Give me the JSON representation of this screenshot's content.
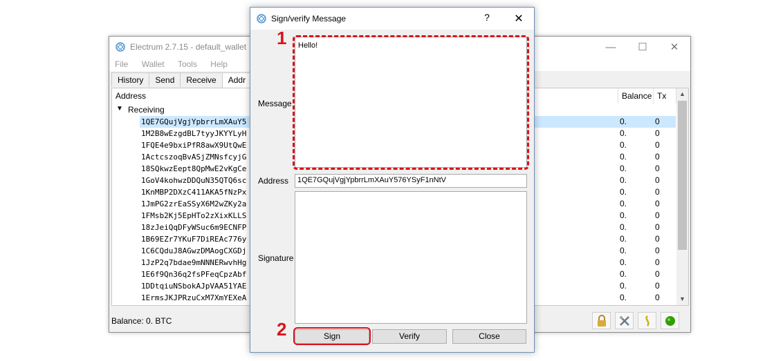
{
  "main_window": {
    "title": "Electrum 2.7.15  -  default_wallet",
    "menu": [
      "File",
      "Wallet",
      "Tools",
      "Help"
    ],
    "tabs": [
      "History",
      "Send",
      "Receive",
      "Addr"
    ],
    "columns": {
      "address": "Address",
      "balance": "Balance",
      "tx": "Tx"
    },
    "tree_group": "Receiving",
    "rows": [
      {
        "address": "1QE7GQujVgjYpbrrLmXAuY5",
        "balance": "0.",
        "tx": "0"
      },
      {
        "address": "1M2B8wEzgdBL7tyyJKYYLyH",
        "balance": "0.",
        "tx": "0"
      },
      {
        "address": "1FQE4e9bxiPfR8awX9UtQwE",
        "balance": "0.",
        "tx": "0"
      },
      {
        "address": "1ActcszoqBvASjZMNsfcyjG",
        "balance": "0.",
        "tx": "0"
      },
      {
        "address": "18SQkwzEept8QpMwE2vKgCe",
        "balance": "0.",
        "tx": "0"
      },
      {
        "address": "1GoV4kohwzDDQuN35QTQ6sc",
        "balance": "0.",
        "tx": "0"
      },
      {
        "address": "1KnMBP2DXzC411AKA5fNzPx",
        "balance": "0.",
        "tx": "0"
      },
      {
        "address": "1JmPG2zrEaSSyX6M2wZKy2a",
        "balance": "0.",
        "tx": "0"
      },
      {
        "address": "1FMsb2Kj5EpHTo2zXixKLLS",
        "balance": "0.",
        "tx": "0"
      },
      {
        "address": "18zJeiQqDFyWSuc6m9ECNFP",
        "balance": "0.",
        "tx": "0"
      },
      {
        "address": "1B69EZr7YKuF7DiREAc776y",
        "balance": "0.",
        "tx": "0"
      },
      {
        "address": "1C6CQduJ8AGwzDMAogCXGDj",
        "balance": "0.",
        "tx": "0"
      },
      {
        "address": "1JzP2q7bdae9mNNNERwvhHg",
        "balance": "0.",
        "tx": "0"
      },
      {
        "address": "1E6f9Qn36q2fsPFeqCpzAbf",
        "balance": "0.",
        "tx": "0"
      },
      {
        "address": "1DDtqiuNSbokAJpVAA51YAE",
        "balance": "0.",
        "tx": "0"
      },
      {
        "address": "1ErmsJKJPRzuCxM7XmYEXeA",
        "balance": "0.",
        "tx": "0"
      }
    ],
    "status_balance": "Balance: 0. BTC",
    "status_icons": [
      "lock-icon",
      "tools-icon",
      "seed-icon",
      "network-status-icon"
    ]
  },
  "dialog": {
    "title": "Sign/verify Message",
    "help": "?",
    "close": "✕",
    "labels": {
      "message": "Message",
      "address": "Address",
      "signature": "Signature"
    },
    "message_value": "Hello!",
    "address_value": "1QE7GQujVgjYpbrrLmXAuY576YSyF1nNtV",
    "signature_value": "",
    "buttons": {
      "sign": "Sign",
      "verify": "Verify",
      "close": "Close"
    }
  },
  "annotations": {
    "step1": "1",
    "step2": "2",
    "color": "#d8151b"
  },
  "colors": {
    "selection": "#cce8ff",
    "network_ok": "#2ea000"
  }
}
